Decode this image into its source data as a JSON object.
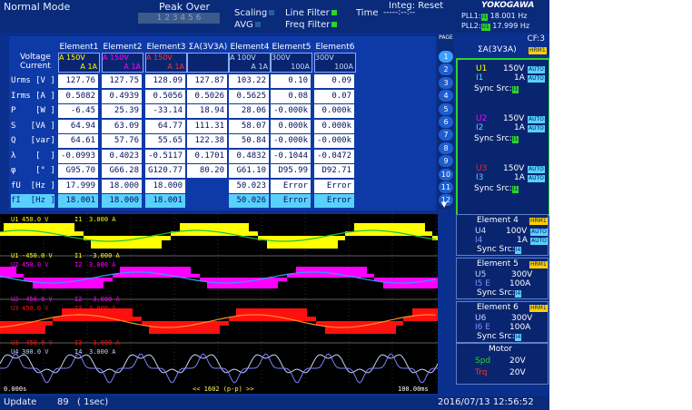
{
  "header": {
    "mode": "Normal Mode",
    "peak_over": "Peak Over",
    "peak_over_channels": "1 2 3 4 5 6",
    "scaling": "Scaling",
    "avg": "AVG",
    "line_filter": "Line Filter",
    "freq_filter": "Freq Filter",
    "time_label": "Time",
    "time_value": "-----:--:--",
    "integ": "Integ: Reset",
    "brand": "YOKOGAWA",
    "pll1_label": "PLL1:",
    "pll1_src": "I1",
    "pll1_value": "18.001 Hz",
    "pll2_label": "PLL2:",
    "pll2_src": "U1",
    "pll2_value": "17.999 Hz",
    "cf": "CF:3"
  },
  "table": {
    "corner_top": "Voltage",
    "corner_bottom": "Current",
    "columns": [
      {
        "name": "Element1",
        "v": "A 150V",
        "i": "A 1A"
      },
      {
        "name": "Element2",
        "v": "A 150V",
        "i": "A 1A"
      },
      {
        "name": "Element3",
        "v": "A 150V",
        "i": "A 1A"
      },
      {
        "name": "ΣA(3V3A)",
        "v": "",
        "i": ""
      },
      {
        "name": "Element4",
        "v": "A 100V",
        "i": "A 1A"
      },
      {
        "name": "Element5",
        "v": "300V",
        "i": "100A"
      },
      {
        "name": "Element6",
        "v": "300V",
        "i": "100A"
      }
    ],
    "rows": [
      {
        "label": "Urms [V ]",
        "values": [
          "127.76",
          "127.75",
          "128.09",
          "127.87",
          "103.22",
          "0.10",
          "0.09"
        ]
      },
      {
        "label": "Irms [A ]",
        "values": [
          "0.5082",
          "0.4939",
          "0.5056",
          "0.5026",
          "0.5625",
          "0.08",
          "0.07"
        ]
      },
      {
        "label": "P    [W ]",
        "values": [
          "-6.45",
          "25.39",
          "-33.14",
          "18.94",
          "28.06",
          "-0.000k",
          "0.000k"
        ]
      },
      {
        "label": "S   [VA ]",
        "values": [
          "64.94",
          "63.09",
          "64.77",
          "111.31",
          "58.07",
          "0.000k",
          "0.000k"
        ]
      },
      {
        "label": "Q   [var]",
        "values": [
          "64.61",
          "57.76",
          "55.65",
          "122.38",
          "50.84",
          "-0.000k",
          "-0.000k"
        ]
      },
      {
        "label": "λ    [  ]",
        "values": [
          "-0.0993",
          "0.4023",
          "-0.5117",
          "0.1701",
          "0.4832",
          "-0.1044",
          "-0.0472"
        ]
      },
      {
        "label": "φ    [° ]",
        "values": [
          "G95.70",
          "G66.28",
          "G120.77",
          "80.20",
          "G61.10",
          "D95.99",
          "D92.71"
        ]
      },
      {
        "label": "fU  [Hz ]",
        "values": [
          "17.999",
          "18.000",
          "18.000",
          "",
          "50.023",
          "Error",
          "Error"
        ]
      },
      {
        "label": "fI  [Hz ]",
        "values": [
          "18.001",
          "18.000",
          "18.001",
          "",
          "50.026",
          "Error",
          "Error"
        ]
      }
    ]
  },
  "page_nav": {
    "title": "PAGE",
    "pages": [
      "1",
      "2",
      "3",
      "4",
      "5",
      "6",
      "7",
      "8",
      "9",
      "10",
      "11",
      "12"
    ]
  },
  "panel": {
    "sigma_title": "ΣA(3V3A)",
    "hrm": "HRM1",
    "auto": "AUTO",
    "sync_src": "Sync Src:",
    "groups": [
      {
        "u": "U1",
        "i": "I1",
        "u_range": "150V",
        "i_range": "1A",
        "sync": "I1",
        "color": "#ffff00"
      },
      {
        "u": "U2",
        "i": "I2",
        "u_range": "150V",
        "i_range": "1A",
        "sync": "I1",
        "color": "#ff00ff"
      },
      {
        "u": "U3",
        "i": "I3",
        "u_range": "150V",
        "i_range": "1A",
        "sync": "I1",
        "color": "#ff2020"
      }
    ],
    "elements": [
      {
        "title": "Element 4",
        "u": "U4",
        "i": "I4",
        "u_range": "100V",
        "i_range": "1A",
        "sync": "I4"
      },
      {
        "title": "Element 5",
        "u": "U5",
        "i": "I5 E",
        "u_range": "300V",
        "i_range": "100A",
        "sync": "I4"
      },
      {
        "title": "Element 6",
        "u": "U6",
        "i": "I6 E",
        "u_range": "300V",
        "i_range": "100A",
        "sync": "I4"
      }
    ],
    "motor": {
      "title": "Motor",
      "spd_label": "Spd",
      "spd_value": "20V",
      "trq_label": "Trq",
      "trq_value": "20V"
    }
  },
  "waveform": {
    "labels": [
      {
        "a": "U1",
        "b": "450.0 V",
        "c": "I1",
        "d": "3.000 A"
      },
      {
        "a": "U1",
        "b": "-450.0 V",
        "c": "I1",
        "d": "-3.000 A"
      },
      {
        "a": "U2",
        "b": "450.0 V",
        "c": "I2",
        "d": "3.000 A"
      },
      {
        "a": "U2",
        "b": "-450.0 V",
        "c": "I2",
        "d": "-3.000 A"
      },
      {
        "a": "U3",
        "b": "450.0 V",
        "c": "I3",
        "d": "3.000 A"
      },
      {
        "a": "U3",
        "b": "-450.0 V",
        "c": "I3",
        "d": "-3.000 A"
      },
      {
        "a": "U4",
        "b": "300.0 V",
        "c": "I4",
        "d": "3.000 A"
      }
    ],
    "time_start": "0.000s",
    "time_end": "100.00ms",
    "points": "<< 1602 (p-p) >>",
    "colors": {
      "u1": "#ffff00",
      "i1": "#20c040",
      "u2": "#ff00ff",
      "i2": "#30a0ff",
      "u3": "#ff1010",
      "i3": "#ff9020",
      "u4": "#c0d8ff",
      "i4": "#8080ff"
    }
  },
  "footer": {
    "update_label": "Update",
    "update_count": "89",
    "update_interval": "( 1sec)",
    "datetime": "2016/07/13 12:56:52"
  }
}
